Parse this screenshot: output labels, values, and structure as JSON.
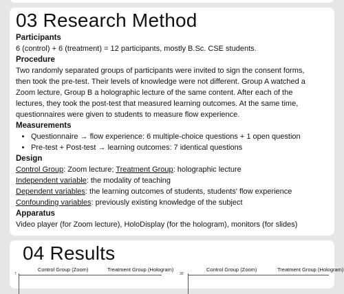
{
  "method": {
    "title": "03 Research Method",
    "participants": {
      "heading": "Participants",
      "text": "6 (control) + 6 (treatment) = 12 participants, mostly B.Sc. CSE students."
    },
    "procedure": {
      "heading": "Procedure",
      "lines": [
        "Two randomly separated groups of participants were invited to sign the consent forms,",
        "then took the pre-test. Their levels of knowledge were not different. Group A watched a",
        "Zoom lecture, Group B a holographic lecture of the same content. After each of the",
        "lectures, they took the post-test that measured learning outcomes. At the same time,",
        "questionnaires were given to students to measure flow experience."
      ]
    },
    "measurements": {
      "heading": "Measurements",
      "items": [
        "Questionnaire → flow experience: 6 multiple-choice questions + 1 open question",
        "Pre-test + Post-test → learning outcomes: 7 identical questions"
      ]
    },
    "design": {
      "heading": "Design",
      "control_term": "Control Group",
      "control_text": ": Zoom lecture; ",
      "treatment_term": "Treatment Group",
      "treatment_text": ": holographic lecture",
      "independent_term": "Independent variable",
      "independent_text": ": the modality of teaching",
      "dependent_term": "Dependent variables",
      "dependent_text": ": the learning outcomes of students, students' flow experience",
      "confounding_term": "Confounding variables",
      "confounding_text": ": previously existing knowledge of the subject"
    },
    "apparatus": {
      "heading": "Apparatus",
      "text": "Video player (for Zoom lecture), HoloDisplay (for the hologram), monitors (for slides)"
    }
  },
  "results": {
    "title": "04 Results",
    "chart_labels": [
      "Control Group (Zoom)",
      "Treatment Group (Hologram)",
      "Control Group (Zoom)",
      "Treatment Group (Hologram)"
    ],
    "left_tick": "7",
    "right_tick": "30"
  }
}
